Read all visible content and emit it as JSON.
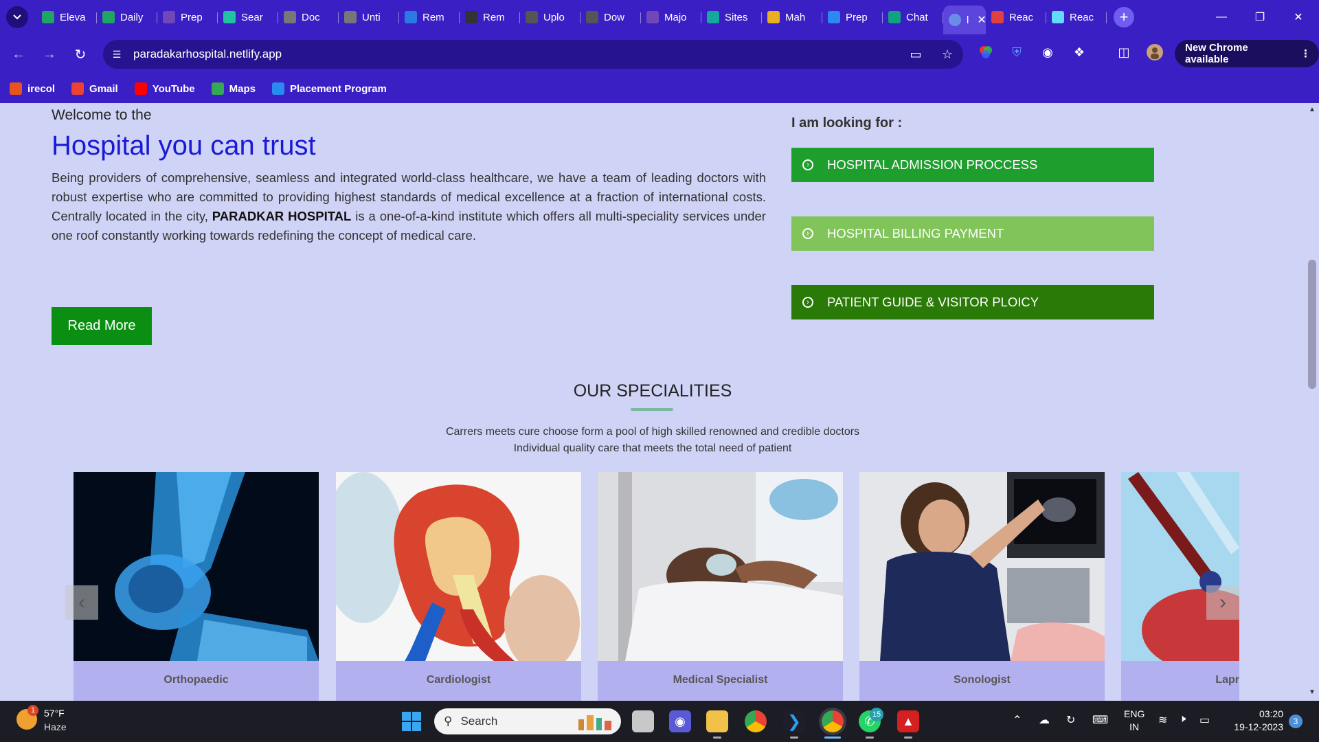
{
  "browser": {
    "tabs": [
      {
        "label": "Eleva",
        "icon": "google-sheets-icon",
        "color": "#1fa463"
      },
      {
        "label": "Daily",
        "icon": "google-sheets-icon",
        "color": "#1fa463"
      },
      {
        "label": "Prep",
        "icon": "google-forms-icon",
        "color": "#7248b9"
      },
      {
        "label": "Sear",
        "icon": "vercel-v-icon",
        "color": "#20c2a0"
      },
      {
        "label": "Doc",
        "icon": "globe-icon",
        "color": "#777777"
      },
      {
        "label": "Unti",
        "icon": "globe-icon",
        "color": "#777777"
      },
      {
        "label": "Rem",
        "icon": "edit-icon",
        "color": "#2a7ae4"
      },
      {
        "label": "Rem",
        "icon": "github-icon",
        "color": "#333333"
      },
      {
        "label": "Uplo",
        "icon": "layers-icon",
        "color": "#555555"
      },
      {
        "label": "Dow",
        "icon": "download-icon",
        "color": "#555555"
      },
      {
        "label": "Majo",
        "icon": "google-forms-icon",
        "color": "#7248b9"
      },
      {
        "label": "Sites",
        "icon": "diamond-icon",
        "color": "#14a89a"
      },
      {
        "label": "Mah",
        "icon": "smiley-icon",
        "color": "#e8b020"
      },
      {
        "label": "Prep",
        "icon": "pb-icon",
        "color": "#2a8af0"
      },
      {
        "label": "Chat",
        "icon": "chatgpt-icon",
        "color": "#10a37f"
      }
    ],
    "active_tab": {
      "label": "l",
      "icon": "hospital-favicon",
      "close": "✕"
    },
    "tabs_after": [
      {
        "label": "Reac",
        "icon": "jsx-icon",
        "color": "#e04040"
      },
      {
        "label": "Reac",
        "icon": "react-icon",
        "color": "#61dafb"
      }
    ],
    "url": "paradakarhospital.netlify.app",
    "update_label": "New Chrome available",
    "bookmarks": [
      {
        "label": "irecol",
        "icon": "irecol-icon",
        "color": "#e8541e"
      },
      {
        "label": "Gmail",
        "icon": "gmail-icon",
        "color": "#ea4335"
      },
      {
        "label": "YouTube",
        "icon": "youtube-icon",
        "color": "#ff0000"
      },
      {
        "label": "Maps",
        "icon": "maps-icon",
        "color": "#34a853"
      },
      {
        "label": "Placement Program",
        "icon": "pb-icon",
        "color": "#2a8af0"
      }
    ]
  },
  "hero": {
    "welcome": "Welcome to the",
    "title": "Hospital you can trust",
    "text_before": "Being providers of comprehensive, seamless and integrated world-class healthcare, we have a team of leading doctors with robust expertise who are committed to providing highest standards of medical excellence at a fraction of international costs. Centrally located in the city, ",
    "text_bold": "PARADKAR HOSPITAL",
    "text_after": " is a one-of-a-kind institute which offers all multi-speciality services under one roof constantly working towards redefining the concept of medical care.",
    "read_more": "Read More"
  },
  "sidebar": {
    "heading": "I am looking for :",
    "buttons": [
      {
        "label": "HOSPITAL ADMISSION PROCCESS",
        "color": "#1e9e2c"
      },
      {
        "label": "HOSPITAL BILLING PAYMENT",
        "color": "#80c45a"
      },
      {
        "label": "PATIENT GUIDE & VISITOR PLOICY",
        "color": "#2a7a08"
      }
    ]
  },
  "specialities": {
    "title": "OUR SPECIALITIES",
    "line1": "Carrers meets cure choose form a pool of high skilled renowned and credible doctors",
    "line2": "Individual quality care that meets the total need of patient",
    "cards": [
      {
        "label": "Orthopaedic"
      },
      {
        "label": "Cardiologist"
      },
      {
        "label": "Medical Specialist"
      },
      {
        "label": "Sonologist"
      },
      {
        "label": "Lapr"
      }
    ]
  },
  "taskbar": {
    "temperature": "57°F",
    "weather": "Haze",
    "weather_badge": "1",
    "search": "Search",
    "whatsapp_badge": "15",
    "lang1": "ENG",
    "lang2": "IN",
    "time": "03:20",
    "date": "19-12-2023",
    "notifications": "3"
  }
}
